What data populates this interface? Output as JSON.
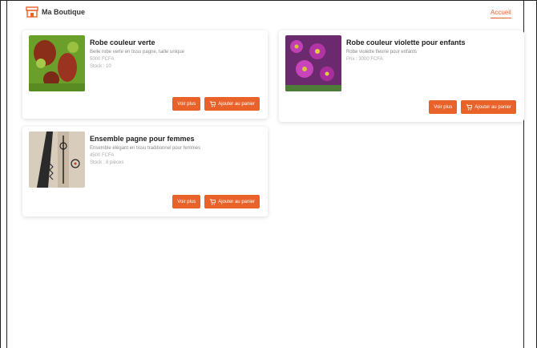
{
  "header": {
    "logo_text": "Ma Boutique",
    "nav_link": "Accueil"
  },
  "products": [
    {
      "title": "Robe couleur verte",
      "description": "Belle robe verte en tissu pagne, taille unique",
      "price": "5000 FCFA",
      "stock": "Stock : 10",
      "details_label": "Voir plus",
      "cart_label": "Ajouter au panier"
    },
    {
      "title": "Robe couleur violette pour enfants",
      "description": "Robe violette fleurie pour enfants",
      "price": "Prix : 3000 FCFA",
      "details_label": "Voir plus",
      "cart_label": "Ajouter au panier"
    },
    {
      "title": "Ensemble pagne pour femmes",
      "description": "Ensemble élégant en tissu traditionnel pour femmes",
      "price": "4500 FCFA",
      "stock": "Stock : 8 pièces",
      "details_label": "Voir plus",
      "cart_label": "Ajouter au panier"
    }
  ],
  "colors": {
    "accent": "#e8622a"
  }
}
